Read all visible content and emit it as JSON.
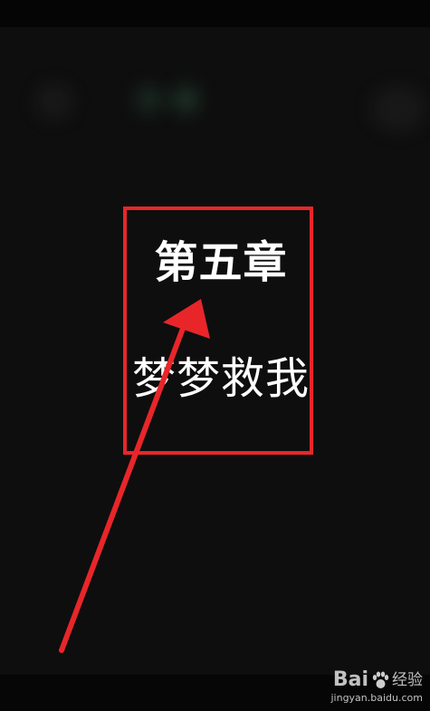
{
  "screen": {
    "chapter_number": "第五章",
    "chapter_title": "梦梦救我"
  },
  "annotation": {
    "highlight_color": "#e8262a",
    "arrow_color": "#e8262a"
  },
  "watermark": {
    "logo_prefix": "Bai",
    "logo_icon": "paw-icon",
    "logo_suffix": "经验",
    "domain": "jingyan.baidu.com"
  }
}
